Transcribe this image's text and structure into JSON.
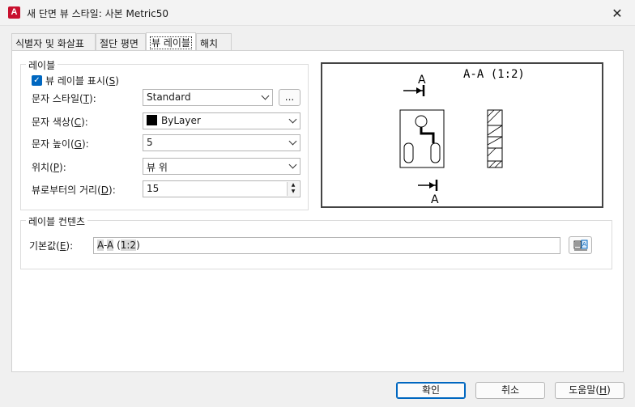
{
  "window": {
    "title": "새 단면 뷰 스타일: 사본 Metric50",
    "app_icon_letter": "A",
    "close_glyph": "✕"
  },
  "tabs": [
    {
      "label": "식별자 및 화살표",
      "active": false
    },
    {
      "label": "절단 평면",
      "active": false
    },
    {
      "label": "뷰 레이블",
      "active": true
    },
    {
      "label": "해치",
      "active": false
    }
  ],
  "label_group": {
    "title": "레이블",
    "show_label": {
      "text": "뷰 레이블 표시(",
      "key": "S",
      "suffix": ")",
      "checked": true,
      "check_glyph": "✓"
    },
    "text_style": {
      "text": "문자 스타일(",
      "key": "T",
      "suffix": "):",
      "value": "Standard",
      "browse_label": "..."
    },
    "text_color": {
      "text": "문자 색상(",
      "key": "C",
      "suffix": "):",
      "value": "ByLayer",
      "swatch_color": "#000000"
    },
    "text_height": {
      "text": "문자 높이(",
      "key": "G",
      "suffix": "):",
      "value": "5"
    },
    "position": {
      "text": "위치(",
      "key": "P",
      "suffix": "):",
      "value": "뷰 위"
    },
    "distance": {
      "text": "뷰로부터의 거리(",
      "key": "D",
      "suffix": "):",
      "value": "15",
      "up_glyph": "▲",
      "down_glyph": "▼"
    }
  },
  "preview": {
    "label_text": "A-A (1:2)",
    "marker_top": "A",
    "marker_bottom": "A"
  },
  "contents_group": {
    "title": "레이블 컨텐츠",
    "default": {
      "text": "기본값(",
      "key": "E",
      "suffix": "):",
      "value_parts": [
        "A",
        "-",
        "A",
        " (",
        "1:2",
        ")"
      ]
    }
  },
  "footer": {
    "ok_label": "확인",
    "cancel_label": "취소",
    "help": {
      "text": "도움말(",
      "key": "H",
      "suffix": ")"
    }
  },
  "colors": {
    "accent": "#0067c0",
    "app_icon": "#c8102e"
  }
}
